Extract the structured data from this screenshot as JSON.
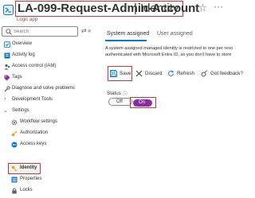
{
  "header": {
    "resource_name": "LA-099-Request-Admin-Account",
    "separator": "|",
    "section": "Identity",
    "resource_type": "Logic app",
    "star_icon": "star-icon",
    "more_icon": "more-options-icon"
  },
  "sidebar": {
    "search_placeholder": "Search",
    "items": [
      {
        "label": "Overview",
        "icon": "overview-icon",
        "color": "#0078d4"
      },
      {
        "label": "Activity log",
        "icon": "activity-log-icon",
        "color": "#0078d4"
      },
      {
        "label": "Access control (IAM)",
        "icon": "iam-icon",
        "color": "#605e5c"
      },
      {
        "label": "Tags",
        "icon": "tag-icon",
        "color": "#8a2da5"
      },
      {
        "label": "Diagnose and solve problems",
        "icon": "wrench-icon",
        "color": "#605e5c"
      },
      {
        "label": "Development Tools",
        "icon": "chevron-right-icon"
      },
      {
        "label": "Settings",
        "icon": "chevron-down-icon"
      },
      {
        "label": "Workflow settings",
        "icon": "gear-icon",
        "color": "#605e5c"
      },
      {
        "label": "Authorization",
        "icon": "key-yellow-icon",
        "color": "#e8a317"
      },
      {
        "label": "Access keys",
        "icon": "access-keys-icon",
        "color": "#0078d4"
      },
      {
        "label": "Identity",
        "icon": "identity-key-icon",
        "color": "#e8a317"
      },
      {
        "label": "Properties",
        "icon": "properties-icon",
        "color": "#0078d4"
      },
      {
        "label": "Locks",
        "icon": "lock-icon",
        "color": "#605e5c"
      }
    ]
  },
  "main": {
    "tabs": [
      {
        "label": "System assigned",
        "active": true
      },
      {
        "label": "User assigned",
        "active": false
      }
    ],
    "description_line1": "A system assigned managed identity is restricted to one per reso",
    "description_line2": "authenticated with Microsoft Entra ID, so you don't have to store",
    "toolbar": {
      "save": "Save",
      "discard": "Discard",
      "refresh": "Refresh",
      "feedback": "Got feedback?"
    },
    "status_label": "Status",
    "toggle": {
      "off": "Off",
      "on": "On",
      "selected": "On"
    }
  },
  "colors": {
    "accent": "#0078d4",
    "highlight_border": "#d13438",
    "toggle_on": "#8a2da5"
  }
}
